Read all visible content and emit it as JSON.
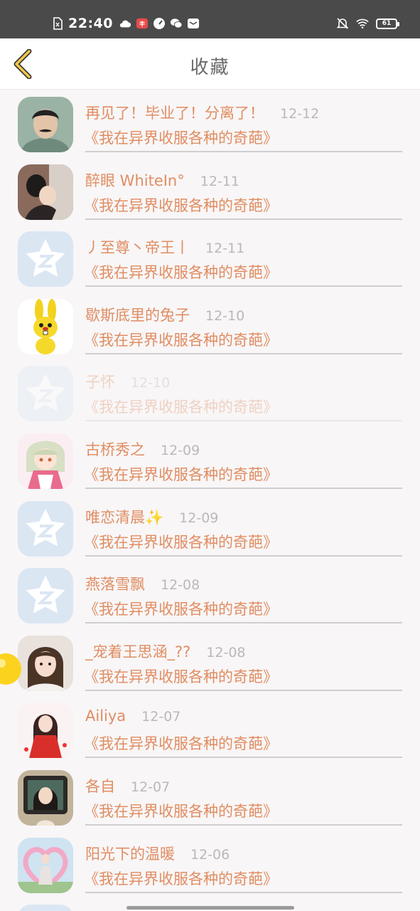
{
  "status_bar": {
    "time": "22:40",
    "icons_left": [
      "sim-card-icon",
      "cloud-icon",
      "app-badge-icon",
      "speedometer-icon",
      "wechat-icon",
      "message-icon"
    ],
    "icons_right": [
      "mute-bell-icon",
      "wifi-icon",
      "battery-icon"
    ],
    "battery_level": "61"
  },
  "header": {
    "title": "收藏",
    "back_icon": "chevron-left-icon",
    "accent_color": "#f2c84b"
  },
  "colors": {
    "name": "#e08d62",
    "date": "#b9b9b9",
    "divider": "#cfcfcf"
  },
  "favorites": [
    {
      "name": "再见了！毕业了！分离了！",
      "date": "12-12",
      "book": "《我在异界收服各种的奇葩》",
      "avatar": "boy-with-mustache-avatar"
    },
    {
      "name": "醉眼 WhiteIn°",
      "date": "12-11",
      "book": "《我在异界收服各种的奇葩》",
      "avatar": "couple-photo-avatar"
    },
    {
      "name": "丿至尊丶帝王丨",
      "date": "12-11",
      "book": "《我在异界收服各种的奇葩》",
      "avatar": "default-qzone-avatar"
    },
    {
      "name": "歇斯底里的兔子",
      "date": "12-10",
      "book": "《我在异界收服各种的奇葩》",
      "avatar": "yellow-rabbit-avatar"
    },
    {
      "name": "子怀",
      "date": "12-10",
      "book": "《我在异界收服各种的奇葩》",
      "avatar": "default-qzone-avatar"
    },
    {
      "name": "古桥秀之",
      "date": "12-09",
      "book": "《我在异界收服各种的奇葩》",
      "avatar": "anime-girl-avatar"
    },
    {
      "name": "唯恋清晨✨",
      "date": "12-09",
      "book": "《我在异界收服各种的奇葩》",
      "avatar": "default-qzone-avatar"
    },
    {
      "name": "燕落雪飘",
      "date": "12-08",
      "book": "《我在异界收服各种的奇葩》",
      "avatar": "default-qzone-avatar"
    },
    {
      "name": "_宠着王思涵_??",
      "date": "12-08",
      "book": "《我在异界收服各种的奇葩》",
      "avatar": "girl-portrait-avatar"
    },
    {
      "name": "Ailiya",
      "date": "12-07",
      "book": "《我在异界收服各种的奇葩》",
      "avatar": "girl-red-dress-avatar"
    },
    {
      "name": "各自",
      "date": "12-07",
      "book": "《我在异界收服各种的奇葩》",
      "avatar": "girl-tv-frame-avatar"
    },
    {
      "name": "阳光下的温暖",
      "date": "12-06",
      "book": "《我在异界收服各种的奇葩》",
      "avatar": "girl-heart-arch-avatar"
    }
  ]
}
